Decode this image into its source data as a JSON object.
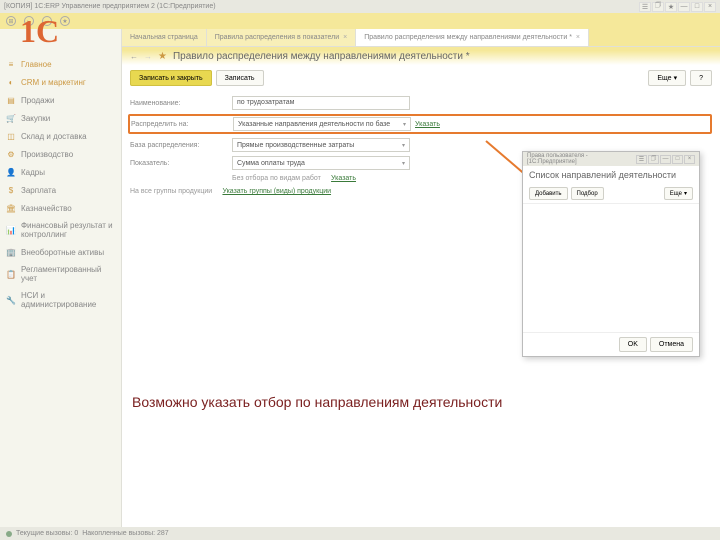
{
  "window": {
    "title": "[КОПИЯ] 1С:ERP Управление предприятием 2 (1С:Предприятие)"
  },
  "sidebar": {
    "items": [
      {
        "label": "Главное"
      },
      {
        "label": "CRM и маркетинг"
      },
      {
        "label": "Продажи"
      },
      {
        "label": "Закупки"
      },
      {
        "label": "Склад и доставка"
      },
      {
        "label": "Производство"
      },
      {
        "label": "Кадры"
      },
      {
        "label": "Зарплата"
      },
      {
        "label": "Казначейство"
      },
      {
        "label": "Финансовый результат и контроллинг"
      },
      {
        "label": "Внеоборотные активы"
      },
      {
        "label": "Регламентированный учет"
      },
      {
        "label": "НСИ и администрирование"
      }
    ]
  },
  "tabs": [
    {
      "label": "Начальная страница"
    },
    {
      "label": "Правила распределения в показатели"
    },
    {
      "label": "Правило распределения между направлениями деятельности *"
    }
  ],
  "page": {
    "title": "Правило распределения между направлениями деятельности *",
    "save_close": "Записать и закрыть",
    "save": "Записать",
    "more": "Еще"
  },
  "form": {
    "name_label": "Наименование:",
    "name_value": "по трудозатратам",
    "dist_label": "Распределить на:",
    "dist_value": "Указанные направления деятельности по базе",
    "dist_link": "Указать",
    "base_label": "База распределения:",
    "base_value": "Прямые производственные затраты",
    "ind_label": "Показатель:",
    "ind_value": "Сумма оплаты труда",
    "filter_hint": "Без отбора по видам работ",
    "filter_link": "Указать",
    "groups_hint": "На все группы продукции",
    "groups_link": "Указать группы (виды) продукции"
  },
  "popup": {
    "hdr": "Права пользователя - [1С:Предприятие]",
    "title": "Список направлений деятельности",
    "add": "Добавить",
    "pick": "Подбор",
    "more": "Еще",
    "ok": "OK",
    "cancel": "Отмена"
  },
  "annotation": "Возможно указать отбор по направлениям деятельности",
  "status": {
    "current": "Текущие вызовы: 0",
    "accum": "Накопленные вызовы: 287"
  }
}
